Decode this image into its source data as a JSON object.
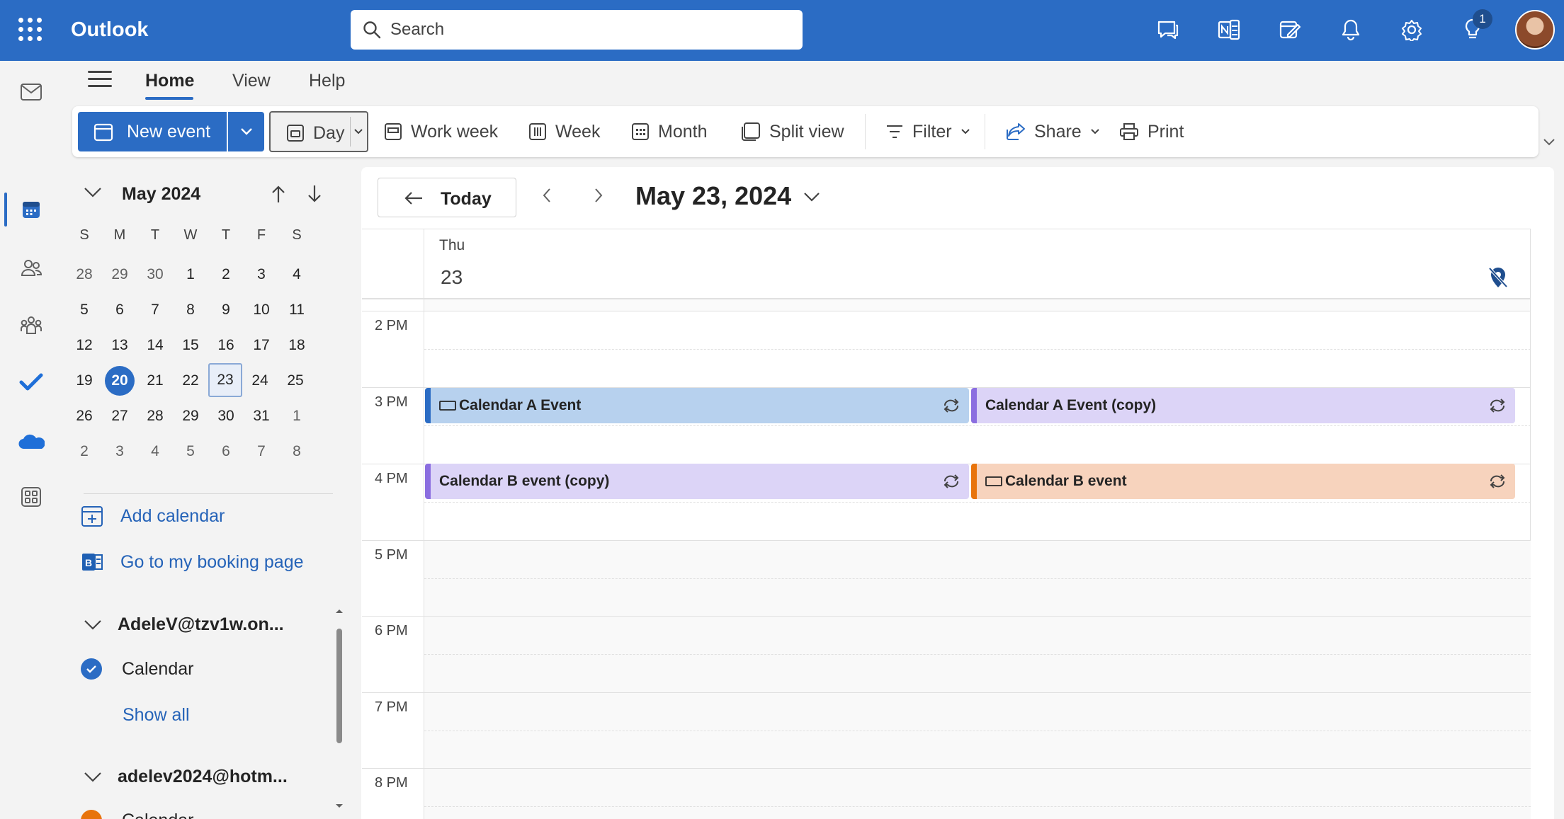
{
  "app": {
    "name": "Outlook"
  },
  "search": {
    "placeholder": "Search"
  },
  "header": {
    "notification_count": "1"
  },
  "tabs": [
    {
      "label": "Home"
    },
    {
      "label": "View"
    },
    {
      "label": "Help"
    }
  ],
  "ribbon": {
    "new_event": "New event",
    "day": "Day",
    "work_week": "Work week",
    "week": "Week",
    "month": "Month",
    "split_view": "Split view",
    "filter": "Filter",
    "share": "Share",
    "print": "Print"
  },
  "mini_calendar": {
    "title": "May 2024",
    "weekdays": [
      "S",
      "M",
      "T",
      "W",
      "T",
      "F",
      "S"
    ],
    "weeks": [
      [
        "28",
        "29",
        "30",
        "1",
        "2",
        "3",
        "4"
      ],
      [
        "5",
        "6",
        "7",
        "8",
        "9",
        "10",
        "11"
      ],
      [
        "12",
        "13",
        "14",
        "15",
        "16",
        "17",
        "18"
      ],
      [
        "19",
        "20",
        "21",
        "22",
        "23",
        "24",
        "25"
      ],
      [
        "26",
        "27",
        "28",
        "29",
        "30",
        "31",
        "1"
      ],
      [
        "2",
        "3",
        "4",
        "5",
        "6",
        "7",
        "8"
      ]
    ],
    "today": "20",
    "selected": "23"
  },
  "sidebar": {
    "add_calendar": "Add calendar",
    "booking_page": "Go to my booking page",
    "account1": "AdeleV@tzv1w.on...",
    "account1_calendar": "Calendar",
    "show_all": "Show all",
    "account2": "adelev2024@hotm...",
    "account2_calendar": "Calendar"
  },
  "main": {
    "today_button": "Today",
    "date_title": "May 23, 2024",
    "day_name": "Thu",
    "day_number": "23",
    "hours": [
      "2 PM",
      "3 PM",
      "4 PM",
      "5 PM",
      "6 PM",
      "7 PM",
      "8 PM"
    ]
  },
  "events": [
    {
      "title": "Calendar A Event",
      "color": "#b7d1ee",
      "bar": "#2b6cc4"
    },
    {
      "title": "Calendar A Event (copy)",
      "color": "#dcd4f7",
      "bar": "#8b6ee0"
    },
    {
      "title": "Calendar B event (copy)",
      "color": "#dcd4f7",
      "bar": "#8b6ee0"
    },
    {
      "title": "Calendar B event",
      "color": "#f7d3bd",
      "bar": "#e8740c"
    }
  ],
  "colors": {
    "brand": "#2b6cc4",
    "accent_link": "#2563b8"
  }
}
